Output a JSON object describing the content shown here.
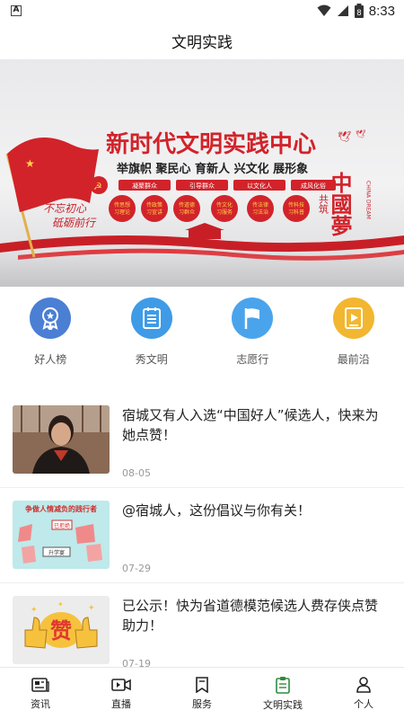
{
  "status_bar": {
    "time": "8:33",
    "battery_level": "8"
  },
  "header": {
    "title": "文明实践"
  },
  "banner": {
    "headline": "新时代文明实践中心",
    "slogan": "举旗帜 聚民心 育新人 兴文化 展形象",
    "tags": [
      "凝聚群众",
      "引导群众",
      "以文化人",
      "成风化俗"
    ],
    "circles": [
      "传思想\n习理论",
      "传政策\n习宣讲",
      "传道德\n习群众",
      "传文化\n习服务",
      "传法律\n习法治",
      "传科技\n习科普"
    ],
    "side_text_1": "不忘初心",
    "side_text_2": "砥砺前行",
    "china_dream": "中國夢",
    "china_dream_side": "共筑",
    "china_dream_en": "CHINA DREAM"
  },
  "quick_menu": [
    {
      "label": "好人榜",
      "icon": "award-badge-icon",
      "color": "#4a7fd4"
    },
    {
      "label": "秀文明",
      "icon": "document-list-icon",
      "color": "#3f9be6"
    },
    {
      "label": "志愿行",
      "icon": "flag-icon",
      "color": "#4aa4ec"
    },
    {
      "label": "最前沿",
      "icon": "video-file-icon",
      "color": "#f2b630"
    }
  ],
  "news": [
    {
      "title": "宿城又有人入选“中国好人”候选人，快来为她点赞！",
      "date": "08-05"
    },
    {
      "title": "@宿城人，这份倡议与你有关！",
      "date": "07-29",
      "thumb_text": "争做人情减负的践行者",
      "thumb_sign": "已拒绝",
      "thumb_sign2": "升学宴"
    },
    {
      "title": "已公示！快为省道德模范候选人费存侠点赞助力！",
      "date": "07-19",
      "thumb_text": "赞"
    }
  ],
  "bottom_nav": [
    {
      "label": "资讯",
      "icon": "news-icon",
      "active": false
    },
    {
      "label": "直播",
      "icon": "video-camera-icon",
      "active": false
    },
    {
      "label": "服务",
      "icon": "bookmark-icon",
      "active": false
    },
    {
      "label": "文明实践",
      "icon": "clipboard-icon",
      "active": true
    },
    {
      "label": "个人",
      "icon": "person-icon",
      "active": false
    }
  ],
  "colors": {
    "active_nav": "#2e8b3e",
    "banner_red": "#d2232a"
  }
}
